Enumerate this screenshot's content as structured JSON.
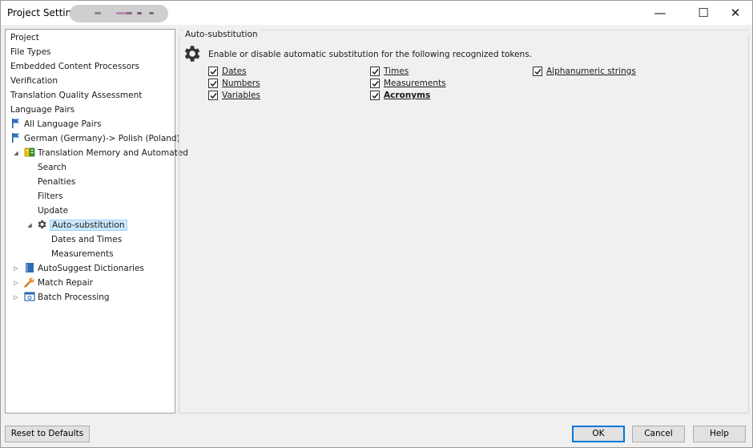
{
  "window": {
    "title": "Project Settings",
    "minimize_glyph": "—",
    "maximize_glyph": "☐",
    "close_glyph": "✕"
  },
  "tree": {
    "items": [
      {
        "label": "Project"
      },
      {
        "label": "File Types"
      },
      {
        "label": "Embedded Content Processors"
      },
      {
        "label": "Verification"
      },
      {
        "label": "Translation Quality Assessment"
      },
      {
        "label": "Language Pairs"
      },
      {
        "label": "All Language Pairs",
        "icon": "flag-icon"
      },
      {
        "label": "German (Germany)-> Polish (Poland)",
        "icon": "flag-icon"
      },
      {
        "label": "Translation Memory and Automated",
        "icon": "translation-memory-icon",
        "expanded": true
      },
      {
        "label": "Search"
      },
      {
        "label": "Penalties"
      },
      {
        "label": "Filters"
      },
      {
        "label": "Update"
      },
      {
        "label": "Auto-substitution",
        "icon": "gear-icon",
        "expanded": true,
        "selected": true
      },
      {
        "label": "Dates and Times"
      },
      {
        "label": "Measurements"
      },
      {
        "label": "AutoSuggest Dictionaries",
        "icon": "book-icon",
        "expanded": false
      },
      {
        "label": "Match Repair",
        "icon": "wrench-icon",
        "expanded": false
      },
      {
        "label": "Batch Processing",
        "icon": "batch-icon",
        "expanded": false
      }
    ]
  },
  "panel": {
    "group_title": "Auto-substitution",
    "description": "Enable or disable automatic substitution for the following recognized tokens.",
    "checkboxes": [
      {
        "label": "Dates",
        "checked": true
      },
      {
        "label": "Numbers",
        "checked": true
      },
      {
        "label": "Variables",
        "checked": true
      },
      {
        "label": "Times",
        "checked": true
      },
      {
        "label": "Measurements",
        "checked": true
      },
      {
        "label": "Acronyms",
        "checked": true
      },
      {
        "label": "Alphanumeric strings",
        "checked": true
      }
    ]
  },
  "buttons": {
    "reset": "Reset to Defaults",
    "ok": "OK",
    "cancel": "Cancel",
    "help": "Help"
  }
}
